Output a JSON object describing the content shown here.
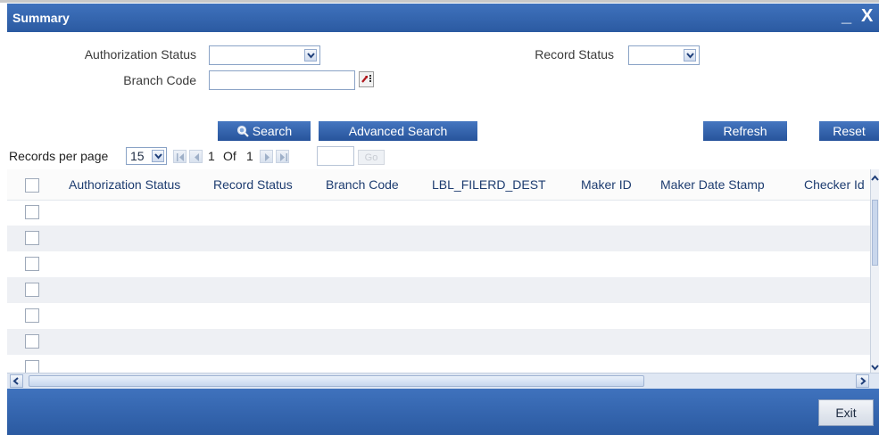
{
  "window": {
    "title": "Summary",
    "minimize": "_",
    "close": "X"
  },
  "criteria": {
    "authorization_status": {
      "label": "Authorization Status",
      "value": ""
    },
    "record_status": {
      "label": "Record Status",
      "value": ""
    },
    "branch_code": {
      "label": "Branch Code",
      "value": ""
    }
  },
  "actions": {
    "search": "Search",
    "advanced_search": "Advanced Search",
    "refresh": "Refresh",
    "reset": "Reset"
  },
  "pagination": {
    "records_per_page_label": "Records per page",
    "records_per_page": "15",
    "current_page": "1",
    "of_label": "Of",
    "total_pages": "1",
    "go_label": "Go"
  },
  "grid": {
    "columns": [
      "Authorization Status",
      "Record Status",
      "Branch Code",
      "LBL_FILERD_DEST",
      "Maker ID",
      "Maker Date Stamp",
      "Checker Id"
    ],
    "row_count": 7
  },
  "footer": {
    "exit": "Exit"
  },
  "colors": {
    "header_blue": "#3566b1",
    "button_blue": "#2f5fa8",
    "row_alt": "#eef0f4"
  }
}
